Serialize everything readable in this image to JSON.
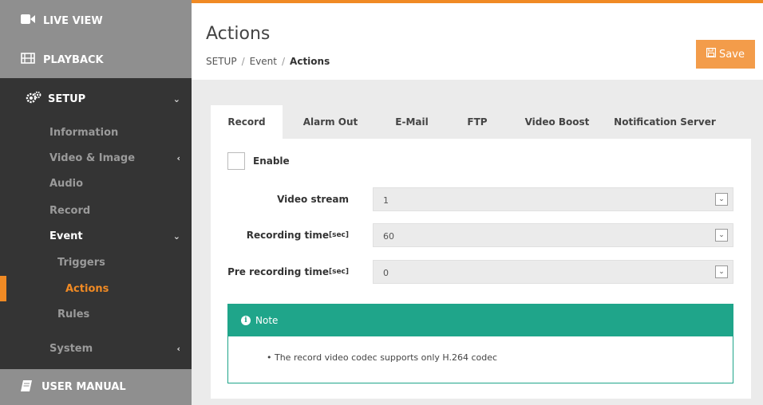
{
  "sidebar": {
    "live_view": "LIVE VIEW",
    "playback": "PLAYBACK",
    "setup": "SETUP",
    "items": [
      {
        "label": "Information"
      },
      {
        "label": "Video & Image"
      },
      {
        "label": "Audio"
      },
      {
        "label": "Record"
      },
      {
        "label": "Event"
      },
      {
        "label": "Triggers"
      },
      {
        "label": "Actions"
      },
      {
        "label": "Rules"
      },
      {
        "label": "System"
      }
    ],
    "user_manual": "USER MANUAL"
  },
  "header": {
    "title": "Actions",
    "breadcrumb": [
      "SETUP",
      "Event",
      "Actions"
    ],
    "save_label": "Save"
  },
  "tabs": [
    {
      "label": "Record"
    },
    {
      "label": "Alarm Out"
    },
    {
      "label": "E-Mail"
    },
    {
      "label": "FTP"
    },
    {
      "label": "Video Boost"
    },
    {
      "label": "Notification Server"
    }
  ],
  "form": {
    "enable_label": "Enable",
    "fields": [
      {
        "label": "Video stream",
        "suffix": "",
        "value": "1"
      },
      {
        "label": "Recording time",
        "suffix": "[sec]",
        "value": "60"
      },
      {
        "label": "Pre recording time",
        "suffix": "[sec]",
        "value": "0"
      }
    ]
  },
  "note": {
    "title": "Note",
    "text": "• The record video codec supports only H.264 codec"
  },
  "colors": {
    "accent": "#f08a24",
    "note": "#1fa58a",
    "sidebar": "#343434"
  }
}
